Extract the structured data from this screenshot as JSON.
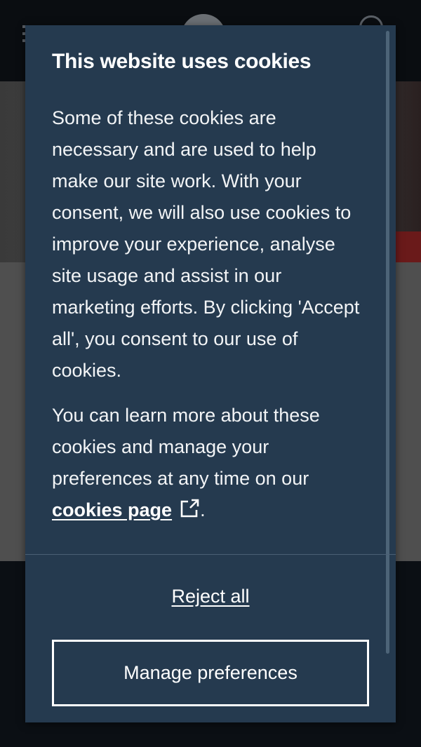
{
  "background": {
    "header_bg": "#0a0d11",
    "content_bg": "#4f4f4f"
  },
  "cookie_dialog": {
    "title": "This website uses cookies",
    "paragraph1": "Some of these cookies are necessary and are used to help make our site work. With your consent, we will also use cookies to improve your experience, analyse site usage and assist in our marketing efforts. By clicking 'Accept all', you consent to our use of cookies.",
    "paragraph2_prefix": "You can learn more about these cookies and manage your preferences at any time on our",
    "cookies_link_label": "cookies page",
    "paragraph2_suffix": ".",
    "link_icon": "external-link-icon",
    "reject_label": "Reject all",
    "manage_label": "Manage preferences",
    "colors": {
      "dialog_bg": "#253a4f",
      "text": "#ffffff"
    }
  }
}
